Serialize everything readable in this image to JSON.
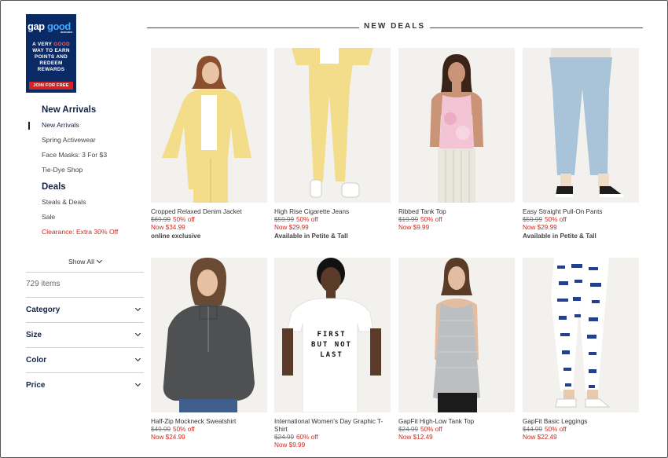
{
  "promo": {
    "logo_text": "gap good",
    "logo_sub": "REWARDS",
    "line1": "A VERY ",
    "line1_highlight": "GOOD",
    "line2": "WAY TO EARN",
    "line3": "POINTS AND",
    "line4": "REDEEM",
    "line5": "REWARDS",
    "cta": "JOIN FOR FREE"
  },
  "sidebar": {
    "section1_heading": "New Arrivals",
    "section1_items": [
      {
        "label": "New Arrivals",
        "active": true
      },
      {
        "label": "Spring Activewear"
      },
      {
        "label": "Face Masks: 3 For $3"
      },
      {
        "label": "Tie-Dye Shop"
      }
    ],
    "section2_heading": "Deals",
    "section2_items": [
      {
        "label": "Steals & Deals"
      },
      {
        "label": "Sale"
      },
      {
        "label": "Clearance: Extra 30% Off",
        "highlight": true
      }
    ],
    "show_all": "Show All",
    "items_count": "729 items",
    "filters": [
      "Category",
      "Size",
      "Color",
      "Price"
    ]
  },
  "main": {
    "section_title": "NEW DEALS"
  },
  "products": [
    {
      "name": "Cropped Relaxed Denim Jacket",
      "was": "$69.99",
      "off": "50% off",
      "now": "Now $34.99",
      "note": "online exclusive",
      "image": "yellow-denim-jacket"
    },
    {
      "name": "High Rise Cigarette Jeans",
      "was": "$59.99",
      "off": "50% off",
      "now": "Now $29.99",
      "note": "Available in Petite & Tall",
      "image": "yellow-jeans"
    },
    {
      "name": "Ribbed Tank Top",
      "was": "$19.99",
      "off": "50% off",
      "now": "Now $9.99",
      "note": "",
      "image": "tie-dye-tank"
    },
    {
      "name": "Easy Straight Pull-On Pants",
      "was": "$59.99",
      "off": "50% off",
      "now": "Now $29.99",
      "note": "Available in Petite & Tall",
      "image": "light-blue-pants"
    },
    {
      "name": "Half-Zip Mockneck Sweatshirt",
      "was": "$49.99",
      "off": "50% off",
      "now": "Now $24.99",
      "note": "",
      "image": "gray-sweatshirt"
    },
    {
      "name": "International Women's Day Graphic T-Shirt",
      "was": "$24.99",
      "off": "60% off",
      "now": "Now $9.99",
      "note": "",
      "image": "graphic-tshirt",
      "tee_text": [
        "FIRST",
        "BUT NOT",
        "LAST"
      ]
    },
    {
      "name": "GapFit High-Low Tank Top",
      "was": "$24.99",
      "off": "50% off",
      "now": "Now $12.49",
      "note": "",
      "image": "gray-tank"
    },
    {
      "name": "GapFit Basic Leggings",
      "was": "$44.99",
      "off": "50% off",
      "now": "Now $22.49",
      "note": "",
      "image": "tie-dye-leggings"
    }
  ],
  "colors": {
    "navy": "#122344",
    "sale_red": "#d12a1e",
    "promo_bg": "#0a2a66"
  }
}
